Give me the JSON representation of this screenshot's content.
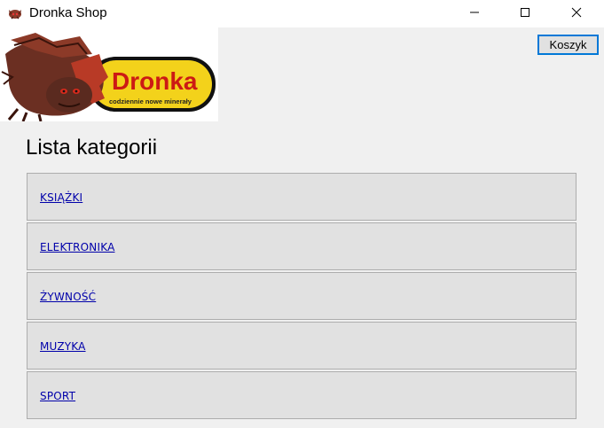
{
  "window": {
    "title": "Dronka Shop",
    "controls": {
      "minimize": "minimize",
      "maximize": "maximize",
      "close": "close"
    }
  },
  "logo": {
    "brand": "Dronka",
    "tagline": "codziennie nowe minerały",
    "icon": "dragon-logo"
  },
  "header": {
    "cart_label": "Koszyk"
  },
  "main": {
    "title": "Lista kategorii",
    "categories": [
      {
        "label": "KSIĄŻKI"
      },
      {
        "label": "ELEKTRONIKA"
      },
      {
        "label": "ŻYWNOŚĆ"
      },
      {
        "label": "MUZYKA"
      },
      {
        "label": "SPORT"
      }
    ]
  },
  "colors": {
    "link": "#0000aa",
    "accent": "#0078d7",
    "logo_yellow": "#f3d21b",
    "logo_red": "#cc1a14"
  }
}
